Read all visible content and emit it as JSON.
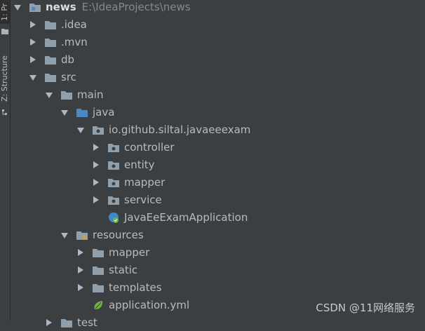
{
  "sidebar": {
    "project_tab": "1: Pr",
    "structure_tab": "Z: Structure"
  },
  "tree": {
    "root": {
      "name": "news",
      "path": "E:\\IdeaProjects\\news"
    },
    "idea": ".idea",
    "mvn": ".mvn",
    "db": "db",
    "src": "src",
    "main": "main",
    "java": "java",
    "package": "io.github.siltal.javaeeexam",
    "controller": "controller",
    "entity": "entity",
    "mapper": "mapper",
    "service": "service",
    "app_class": "JavaEeExamApplication",
    "resources": "resources",
    "res_mapper": "mapper",
    "static": "static",
    "templates": "templates",
    "app_yml": "application.yml",
    "test": "test"
  },
  "icons": {
    "folder": "folder-icon",
    "source_root": "source-root-folder-icon",
    "package": "package-icon",
    "resources_root": "resources-root-folder-icon",
    "spring_class": "spring-boot-class-icon",
    "spring_yml": "spring-config-file-icon",
    "module": "module-icon"
  },
  "colors": {
    "background": "#3c3f41",
    "folder": "#8f9fac",
    "source_root": "#4a88c7",
    "spring": "#6db33f",
    "selection": "#0d293e"
  },
  "watermark": "CSDN @11网络服务"
}
